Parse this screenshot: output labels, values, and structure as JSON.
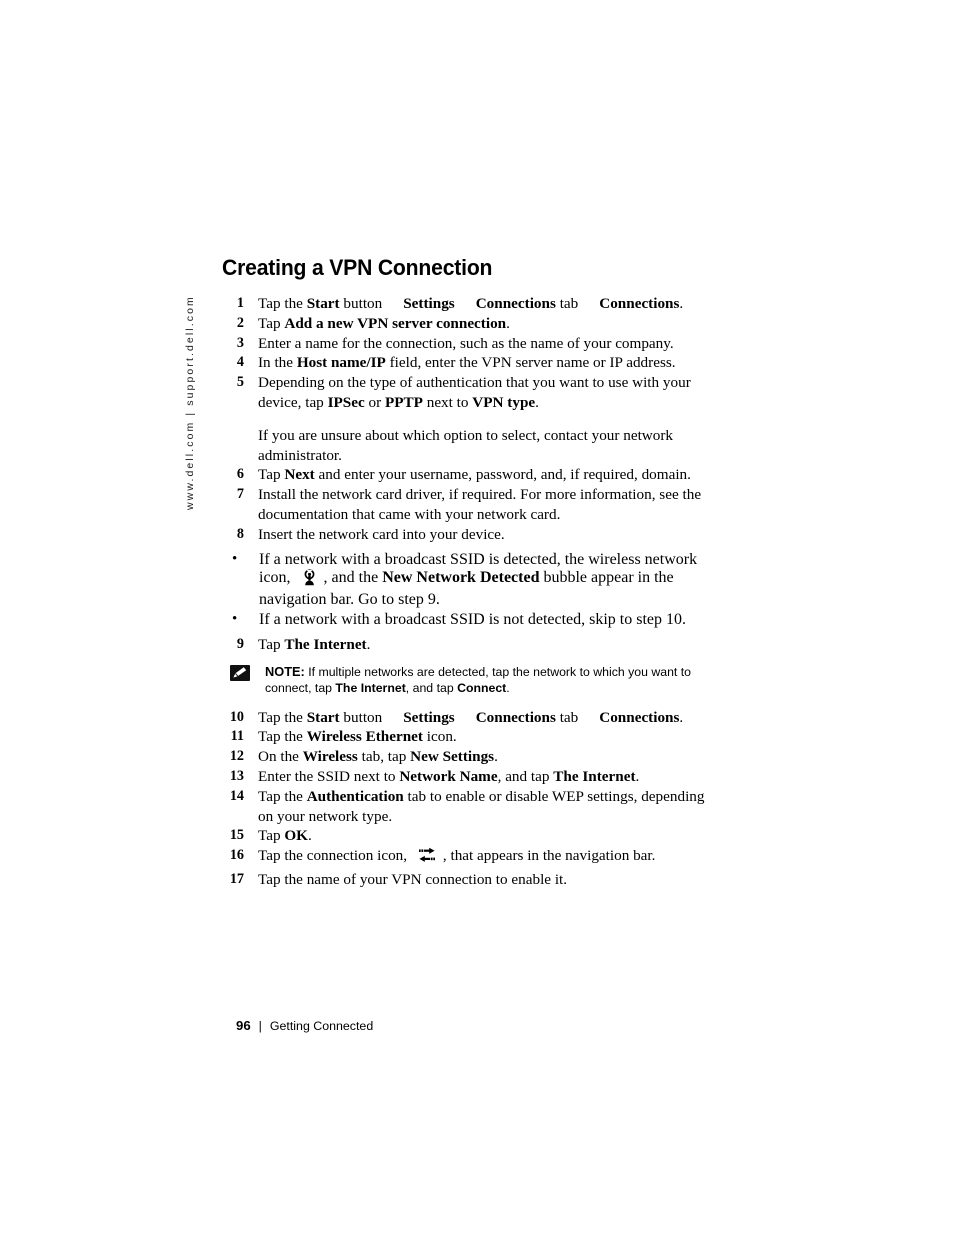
{
  "side_rule": {
    "text": "www.dell.com | support.dell.com"
  },
  "page": {
    "title": "Creating a VPN Connection"
  },
  "steps": [
    {
      "num": "1",
      "segments": [
        {
          "t": "Tap the ",
          "b": false
        },
        {
          "t": "Start",
          "b": true
        },
        {
          "t": " button",
          "b": false
        },
        {
          "gap": true
        },
        {
          "t": "Settings",
          "b": true
        },
        {
          "gap": true
        },
        {
          "t": "Connections",
          "b": true
        },
        {
          "t": " tab",
          "b": false
        },
        {
          "gap": true
        },
        {
          "t": "Connections",
          "b": true
        },
        {
          "t": ".",
          "b": false
        }
      ]
    },
    {
      "num": "2",
      "segments": [
        {
          "t": "Tap ",
          "b": false
        },
        {
          "t": "Add a new VPN server connection",
          "b": true
        },
        {
          "t": ".",
          "b": false
        }
      ]
    },
    {
      "num": "3",
      "segments": [
        {
          "t": "Enter a name for the connection, such as the name of your company.",
          "b": false
        }
      ]
    },
    {
      "num": "4",
      "segments": [
        {
          "t": "In the ",
          "b": false
        },
        {
          "t": "Host name/IP",
          "b": true
        },
        {
          "t": " field, enter the VPN server name or IP address.",
          "b": false
        }
      ]
    },
    {
      "num": "5",
      "segments": [
        {
          "t": "Depending on the type of authentication that you want to use with your device, tap ",
          "b": false
        },
        {
          "t": "IPSec",
          "b": true
        },
        {
          "t": " or ",
          "b": false
        },
        {
          "t": "PPTP",
          "b": true
        },
        {
          "t": " next to ",
          "b": false
        },
        {
          "t": "VPN type",
          "b": true
        },
        {
          "t": ".",
          "b": false
        }
      ],
      "extra_para": "If you are unsure about which option to select, contact your network administrator."
    },
    {
      "num": "6",
      "segments": [
        {
          "t": "Tap ",
          "b": false
        },
        {
          "t": "Next",
          "b": true
        },
        {
          "t": " and enter your username, password, and, if required, domain.",
          "b": false
        }
      ]
    },
    {
      "num": "7",
      "segments": [
        {
          "t": "Install the network card driver, if required. For more information, see the documentation that came with your network card.",
          "b": false
        }
      ]
    },
    {
      "num": "8",
      "segments": [
        {
          "t": "Insert the network card into your device.",
          "b": false
        }
      ]
    }
  ],
  "bullets": [
    {
      "marker": "•",
      "segments": [
        {
          "t": "If a network with a broadcast SSID is detected, the wireless network icon, ",
          "b": false
        },
        {
          "icon": "wireless-network-icon"
        },
        {
          "t": ", and the ",
          "b": false
        },
        {
          "t": "New Network Detected",
          "b": true
        },
        {
          "t": " bubble appear in the navigation bar. Go to step 9.",
          "b": false
        }
      ]
    },
    {
      "marker": "•",
      "segments": [
        {
          "t": "If a network with a broadcast SSID is not detected, skip to step 10.",
          "b": false
        }
      ]
    }
  ],
  "step9": {
    "num": "9",
    "segments": [
      {
        "t": "Tap ",
        "b": false
      },
      {
        "t": "The Internet",
        "b": true
      },
      {
        "t": ".",
        "b": false
      }
    ]
  },
  "note": {
    "icon": "pencil-note-icon",
    "label": "NOTE:",
    "segments": [
      {
        "t": " If multiple networks are detected, tap the network to which you want to connect, tap ",
        "b": false
      },
      {
        "t": "The Internet",
        "b": true
      },
      {
        "t": ", and tap ",
        "b": false
      },
      {
        "t": "Connect",
        "b": true
      },
      {
        "t": ".",
        "b": false
      }
    ]
  },
  "steps_after_note": [
    {
      "num": "10",
      "segments": [
        {
          "t": "Tap the ",
          "b": false
        },
        {
          "t": "Start",
          "b": true
        },
        {
          "t": " button",
          "b": false
        },
        {
          "gap": true
        },
        {
          "t": "Settings",
          "b": true
        },
        {
          "gap": true
        },
        {
          "t": "Connections",
          "b": true
        },
        {
          "t": " tab",
          "b": false
        },
        {
          "gap": true
        },
        {
          "t": "Connections",
          "b": true
        },
        {
          "t": ".",
          "b": false
        }
      ]
    },
    {
      "num": "11",
      "segments": [
        {
          "t": "Tap the ",
          "b": false
        },
        {
          "t": "Wireless Ethernet",
          "b": true
        },
        {
          "t": " icon.",
          "b": false
        }
      ]
    },
    {
      "num": "12",
      "segments": [
        {
          "t": "On the ",
          "b": false
        },
        {
          "t": "Wireless",
          "b": true
        },
        {
          "t": " tab, tap ",
          "b": false
        },
        {
          "t": "New Settings",
          "b": true
        },
        {
          "t": ".",
          "b": false
        }
      ]
    },
    {
      "num": "13",
      "segments": [
        {
          "t": "Enter the SSID next to ",
          "b": false
        },
        {
          "t": "Network Name",
          "b": true
        },
        {
          "t": ", and tap ",
          "b": false
        },
        {
          "t": "The Internet",
          "b": true
        },
        {
          "t": ".",
          "b": false
        }
      ]
    },
    {
      "num": "14",
      "segments": [
        {
          "t": "Tap the ",
          "b": false
        },
        {
          "t": "Authentication",
          "b": true
        },
        {
          "t": " tab to enable or disable WEP settings, depending on your network type.",
          "b": false
        }
      ]
    },
    {
      "num": "15",
      "segments": [
        {
          "t": "Tap ",
          "b": false
        },
        {
          "t": "OK",
          "b": true
        },
        {
          "t": ".",
          "b": false
        }
      ]
    },
    {
      "num": "16",
      "segments": [
        {
          "t": "Tap the connection icon, ",
          "b": false
        },
        {
          "icon": "network-connection-icon"
        },
        {
          "t": ", that appears in the navigation bar.",
          "b": false
        }
      ]
    },
    {
      "num": "17",
      "segments": [
        {
          "t": "Tap the name of your VPN connection to enable it.",
          "b": false
        }
      ]
    }
  ],
  "footer": {
    "page_number": "96",
    "separator": "|",
    "chapter": "Getting Connected"
  }
}
